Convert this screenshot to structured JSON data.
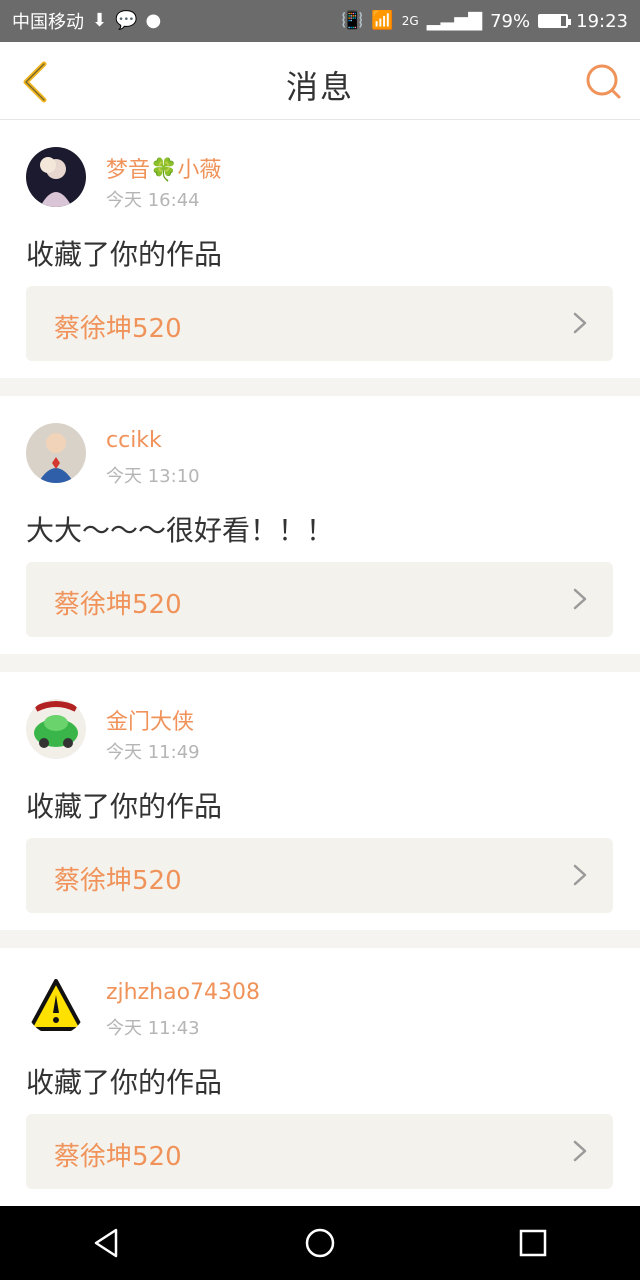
{
  "status_bar": {
    "carrier": "中国移动",
    "network": "2G",
    "battery": "79%",
    "time": "19:23"
  },
  "header": {
    "title": "消息"
  },
  "messages": [
    {
      "name": "梦音🍀小薇",
      "time": "今天 16:44",
      "text": "收藏了你的作品",
      "work_title": "蔡徐坤520"
    },
    {
      "name": "ccikk",
      "time": "今天 13:10",
      "text": "大大～～～很好看！！！",
      "work_title": "蔡徐坤520"
    },
    {
      "name": "金门大侠",
      "time": "今天 11:49",
      "text": "收藏了你的作品",
      "work_title": "蔡徐坤520"
    },
    {
      "name": "zjhzhao74308",
      "time": "今天 11:43",
      "text": "收藏了你的作品",
      "work_title": "蔡徐坤520"
    }
  ],
  "colors": {
    "accent": "#f0935a",
    "back_icon": "#f3b51f",
    "search_icon": "#f0935a"
  }
}
